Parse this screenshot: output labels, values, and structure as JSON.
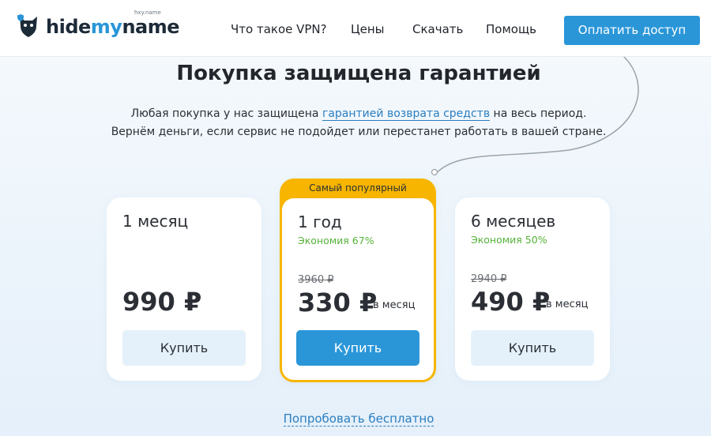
{
  "header": {
    "logo": {
      "hide": "hide",
      "my": "my",
      "name": "name",
      "domain": "hxy.name"
    },
    "nav": [
      "Что такое VPN?",
      "Цены",
      "Скачать",
      "Помощь"
    ],
    "pay_button": "Оплатить доступ"
  },
  "hero": {
    "title": "Покупка защищена гарантией",
    "line1_prefix": "Любая покупка у нас защищена ",
    "line1_link": "гарантией возврата средств",
    "line1_suffix": " на весь период.",
    "line2": "Вернём деньги, если сервис не подойдет или перестанет работать в вашей стране."
  },
  "plans": [
    {
      "name": "1 месяц",
      "saving": "",
      "old_price": "",
      "price": "990 ₽",
      "per": "",
      "button": "Купить"
    },
    {
      "name": "1 год",
      "badge": "Самый популярный",
      "saving": "Экономия 67%",
      "old_price": "3960 ₽",
      "price": "330 ₽",
      "per": "в месяц",
      "button": "Купить"
    },
    {
      "name": "6 месяцев",
      "saving": "Экономия 50%",
      "old_price": "2940 ₽",
      "price": "490 ₽",
      "per": "в месяц",
      "button": "Купить"
    }
  ],
  "trial_link": "Попробовать бесплатно",
  "colors": {
    "accent": "#2a96d8",
    "popular": "#f7b500",
    "saving": "#55b239"
  }
}
